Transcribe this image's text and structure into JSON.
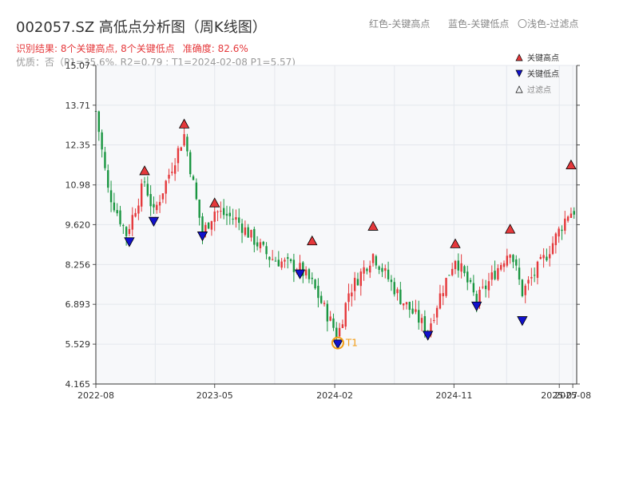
{
  "header": {
    "title": "002057.SZ 高低点分析图（周K线图）",
    "legend_red": "红色-关键高点",
    "legend_blue": "蓝色-关键低点",
    "legend_light": "〇浅色-过滤点",
    "result": "识别结果: 8个关键高点, 8个关键低点",
    "accuracy": "准确度: 82.6%",
    "quality": "优质：否（P1=35.6%, R2=0.79 ; T1=2024-02-08 P1=5.57)"
  },
  "colors": {
    "up": "#e5383b",
    "down": "#1a9641",
    "high_marker": "#e5383b",
    "low_marker": "#1111cc",
    "t1": "#f39c12"
  },
  "chart_data": {
    "type": "candlestick",
    "y_ticks": [
      "4.165",
      "5.529",
      "6.893",
      "8.256",
      "9.620",
      "10.98",
      "12.35",
      "13.71",
      "15.07"
    ],
    "y_tick_values": [
      4.165,
      5.529,
      6.893,
      8.256,
      9.62,
      10.98,
      12.35,
      13.71,
      15.07
    ],
    "ylim": [
      4.165,
      15.07
    ],
    "x_ticks": [
      "2022-08",
      "2023-05",
      "2024-02",
      "2024-11",
      "2025-07",
      "2025-08"
    ],
    "x_tick_dates": [
      "2022-08-01",
      "2023-05-01",
      "2024-02-01",
      "2024-11-01",
      "2025-07-01",
      "2025-08-01"
    ],
    "xlim": [
      "2022-08-01",
      "2025-08-10"
    ],
    "grid": true,
    "legend_position": "top-right",
    "legend": [
      {
        "label": "关键高点",
        "marker": "triangle-up",
        "color": "#e5383b"
      },
      {
        "label": "关键低点",
        "marker": "triangle-down",
        "color": "#1111cc"
      },
      {
        "label": "过滤点",
        "marker": "triangle-up-hollow",
        "color": "#999999"
      }
    ],
    "anchors": [
      [
        "2022-08-01",
        13.5
      ],
      [
        "2022-08-29",
        10.8
      ],
      [
        "2022-10-10",
        9.3
      ],
      [
        "2022-11-21",
        11.1
      ],
      [
        "2022-12-12",
        10.0
      ],
      [
        "2023-02-20",
        12.7
      ],
      [
        "2023-04-03",
        9.3
      ],
      [
        "2023-05-01",
        10.1
      ],
      [
        "2023-06-19",
        9.8
      ],
      [
        "2023-09-04",
        8.5
      ],
      [
        "2023-11-13",
        8.1
      ],
      [
        "2023-12-11",
        7.6
      ],
      [
        "2024-02-08",
        5.8
      ],
      [
        "2024-03-04",
        7.3
      ],
      [
        "2024-04-29",
        8.6
      ],
      [
        "2024-07-01",
        7.1
      ],
      [
        "2024-09-02",
        6.0
      ],
      [
        "2024-09-30",
        7.2
      ],
      [
        "2024-11-04",
        8.5
      ],
      [
        "2024-12-23",
        7.0
      ],
      [
        "2025-03-10",
        8.8
      ],
      [
        "2025-04-07",
        7.3
      ],
      [
        "2025-06-02",
        8.6
      ],
      [
        "2025-07-21",
        10.0
      ],
      [
        "2025-08-04",
        10.1
      ]
    ],
    "key_highs": [
      {
        "date": "2022-11-21",
        "value": 11.3
      },
      {
        "date": "2023-02-20",
        "value": 12.9
      },
      {
        "date": "2023-05-01",
        "value": 10.2
      },
      {
        "date": "2023-12-11",
        "value": 8.9
      },
      {
        "date": "2024-04-29",
        "value": 9.4
      },
      {
        "date": "2024-11-04",
        "value": 8.8
      },
      {
        "date": "2025-03-10",
        "value": 9.3
      },
      {
        "date": "2025-07-28",
        "value": 11.5
      }
    ],
    "key_lows": [
      {
        "date": "2022-10-17",
        "value": 9.2
      },
      {
        "date": "2022-12-12",
        "value": 9.9
      },
      {
        "date": "2023-04-03",
        "value": 9.4
      },
      {
        "date": "2023-11-13",
        "value": 8.1
      },
      {
        "date": "2024-02-08",
        "value": 5.7
      },
      {
        "date": "2024-09-02",
        "value": 6.0
      },
      {
        "date": "2024-12-23",
        "value": 7.0
      },
      {
        "date": "2025-04-07",
        "value": 6.5
      }
    ],
    "t1": {
      "label": "T1",
      "date": "2024-02-08",
      "value": 5.57
    }
  }
}
